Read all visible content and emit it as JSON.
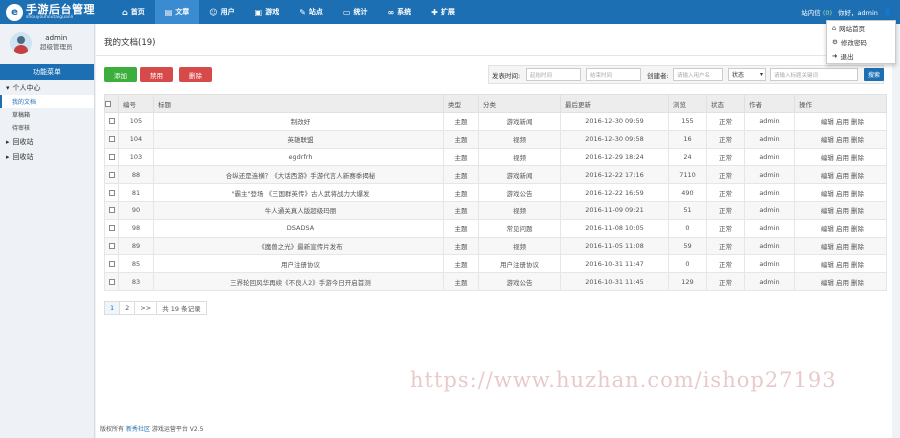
{
  "app": {
    "logo_mark": "e",
    "title": "手游后台管理",
    "subtitle": "shouyouhoutaiguanli"
  },
  "nav": [
    {
      "icon": "home-icon",
      "glyph": "⌂",
      "label": "首页"
    },
    {
      "icon": "chart-icon",
      "glyph": "▤",
      "label": "文章",
      "active": true
    },
    {
      "icon": "user-icon",
      "glyph": "☺",
      "label": "用户"
    },
    {
      "icon": "game-icon",
      "glyph": "▣",
      "label": "游戏"
    },
    {
      "icon": "site-icon",
      "glyph": "✎",
      "label": "站点"
    },
    {
      "icon": "monitor-icon",
      "glyph": "▭",
      "label": "统计"
    },
    {
      "icon": "link-icon",
      "glyph": "∞",
      "label": "系统"
    },
    {
      "icon": "puzzle-icon",
      "glyph": "✚",
      "label": "扩展"
    }
  ],
  "topright": {
    "lang": "站内信",
    "lang_count": "(0)",
    "greeting": "你好，",
    "user": "admin"
  },
  "dropdown": [
    {
      "icon": "home-icon",
      "glyph": "⌂",
      "label": "网站首页"
    },
    {
      "icon": "gear-icon",
      "glyph": "⚙",
      "label": "修改密码"
    },
    {
      "icon": "logout-icon",
      "glyph": "➜",
      "label": "退出"
    }
  ],
  "sidebar": {
    "user_name": "admin",
    "user_role": "超级管理员",
    "menu_header": "功能菜单",
    "groups": [
      {
        "label": "个人中心",
        "glyph": "▾"
      },
      {
        "label": "回收站",
        "glyph": "▸"
      },
      {
        "label": "回收站",
        "glyph": "▸"
      }
    ],
    "sub_items": [
      "我的文档",
      "草稿箱",
      "待审核"
    ]
  },
  "main": {
    "title": "我的文档(19)",
    "buttons": {
      "add": "添加",
      "disable": "禁用",
      "delete": "删除"
    },
    "filter": {
      "time_label": "发表时间:",
      "start_placeholder": "起始时间",
      "end_placeholder": "结束时间",
      "author_label": "创建者:",
      "author_placeholder": "请输入用户名",
      "status_select": "状态",
      "keyword_placeholder": "请输入标题关键词",
      "search_label": "搜索"
    },
    "columns": [
      "编号",
      "标题",
      "类型",
      "分类",
      "最后更新",
      "浏览",
      "状态",
      "作者",
      "操作"
    ],
    "rows": [
      {
        "id": "105",
        "title": "制改好",
        "type": "主题",
        "category": "游戏新闻",
        "updated": "2016-12-30 09:59",
        "views": "155",
        "status": "正常",
        "author": "admin",
        "ops": "编辑 启用 删除"
      },
      {
        "id": "104",
        "title": "英雄联盟",
        "type": "主题",
        "category": "视频",
        "updated": "2016-12-30 09:58",
        "views": "16",
        "status": "正常",
        "author": "admin",
        "ops": "编辑 启用 删除"
      },
      {
        "id": "103",
        "title": "egdrfrh",
        "type": "主题",
        "category": "视频",
        "updated": "2016-12-29 18:24",
        "views": "24",
        "status": "正常",
        "author": "admin",
        "ops": "编辑 启用 删除"
      },
      {
        "id": "88",
        "title": "合纵还是连横？《大话西游》手游代言人新赛季揭秘",
        "type": "主题",
        "category": "游戏新闻",
        "updated": "2016-12-22 17:16",
        "views": "7110",
        "status": "正常",
        "author": "admin",
        "ops": "编辑 启用 删除"
      },
      {
        "id": "81",
        "title": "\"霸主\"登场 《三国群英传》古人武将战力大爆发",
        "type": "主题",
        "category": "游戏公告",
        "updated": "2016-12-22 16:59",
        "views": "490",
        "status": "正常",
        "author": "admin",
        "ops": "编辑 启用 删除"
      },
      {
        "id": "90",
        "title": "牛人通关真人版超级玛丽",
        "type": "主题",
        "category": "视频",
        "updated": "2016-11-09 09:21",
        "views": "51",
        "status": "正常",
        "author": "admin",
        "ops": "编辑 启用 删除"
      },
      {
        "id": "98",
        "title": "DSADSA",
        "type": "主题",
        "category": "常见问题",
        "updated": "2016-11-08 10:05",
        "views": "0",
        "status": "正常",
        "author": "admin",
        "ops": "编辑 启用 删除"
      },
      {
        "id": "89",
        "title": "《魔兽之光》最新宣传片发布",
        "type": "主题",
        "category": "视频",
        "updated": "2016-11-05 11:08",
        "views": "59",
        "status": "正常",
        "author": "admin",
        "ops": "编辑 启用 删除"
      },
      {
        "id": "85",
        "title": "用户注册协议",
        "type": "主题",
        "category": "用户注册协议",
        "updated": "2016-10-31 11:47",
        "views": "0",
        "status": "正常",
        "author": "admin",
        "ops": "编辑 启用 删除"
      },
      {
        "id": "83",
        "title": "三界轮回风华再续《不良人2》手游今日开启首测",
        "type": "主题",
        "category": "游戏公告",
        "updated": "2016-10-31 11:45",
        "views": "129",
        "status": "正常",
        "author": "admin",
        "ops": "编辑 启用 删除"
      }
    ],
    "pager": [
      "1",
      "2",
      ">>",
      "共 19 条记录"
    ]
  },
  "footer": {
    "prefix": "版权所有",
    "link": "新秀社区",
    "suffix": "游戏运营平台 V2.5"
  },
  "watermark": "https://www.huzhan.com/ishop27193"
}
